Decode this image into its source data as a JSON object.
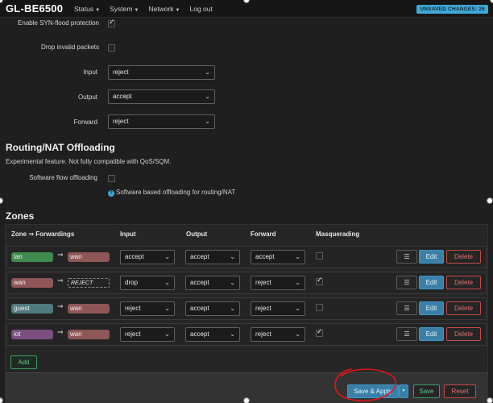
{
  "topbar": {
    "brand": "GL-BE6500",
    "menu": [
      "Status",
      "System",
      "Network",
      "Log out"
    ],
    "unsaved_badge": "UNSAVED CHANGES: 26"
  },
  "general": {
    "syn_flood_label": "Enable SYN-flood protection",
    "syn_flood_checked": true,
    "drop_invalid_label": "Drop invalid packets",
    "drop_invalid_checked": false,
    "input_label": "Input",
    "input_value": "reject",
    "output_label": "Output",
    "output_value": "accept",
    "forward_label": "Forward",
    "forward_value": "reject"
  },
  "offloading": {
    "title": "Routing/NAT Offloading",
    "description": "Experimental feature. Not fully compatible with QoS/SQM.",
    "sw_offload_label": "Software flow offloading",
    "sw_offload_checked": false,
    "sw_offload_help": "Software based offloading for routing/NAT"
  },
  "zones": {
    "title": "Zones",
    "headers": {
      "zone": "Zone ⇒ Forwardings",
      "input": "Input",
      "output": "Output",
      "forward": "Forward",
      "masq": "Masquerading"
    },
    "rows": [
      {
        "name": "lan",
        "color": "#3e8a4f",
        "fwd": "wan",
        "fwd_color": "#8e5656",
        "input": "accept",
        "output": "accept",
        "forward": "accept",
        "masq": false
      },
      {
        "name": "wan",
        "color": "#8e5656",
        "fwd": "REJECT",
        "fwd_color": "",
        "input": "drop",
        "output": "accept",
        "forward": "reject",
        "masq": true
      },
      {
        "name": "guest",
        "color": "#4f7a7f",
        "fwd": "wan",
        "fwd_color": "#8e5656",
        "input": "reject",
        "output": "accept",
        "forward": "reject",
        "masq": false
      },
      {
        "name": "iot",
        "color": "#7a4f80",
        "fwd": "wan",
        "fwd_color": "#8e5656",
        "input": "reject",
        "output": "accept",
        "forward": "reject",
        "masq": true
      }
    ],
    "row_buttons": {
      "menu": "☰",
      "edit": "Edit",
      "delete": "Delete"
    },
    "add_button": "Add"
  },
  "footer": {
    "save_apply": "Save & Apply",
    "dropdown": "▾",
    "save": "Save",
    "reset": "Reset"
  },
  "colors": {
    "accent": "#3a7fa7",
    "save_green": "#62c58e",
    "danger_red": "#e07070",
    "annotation_red": "#e0151b"
  }
}
